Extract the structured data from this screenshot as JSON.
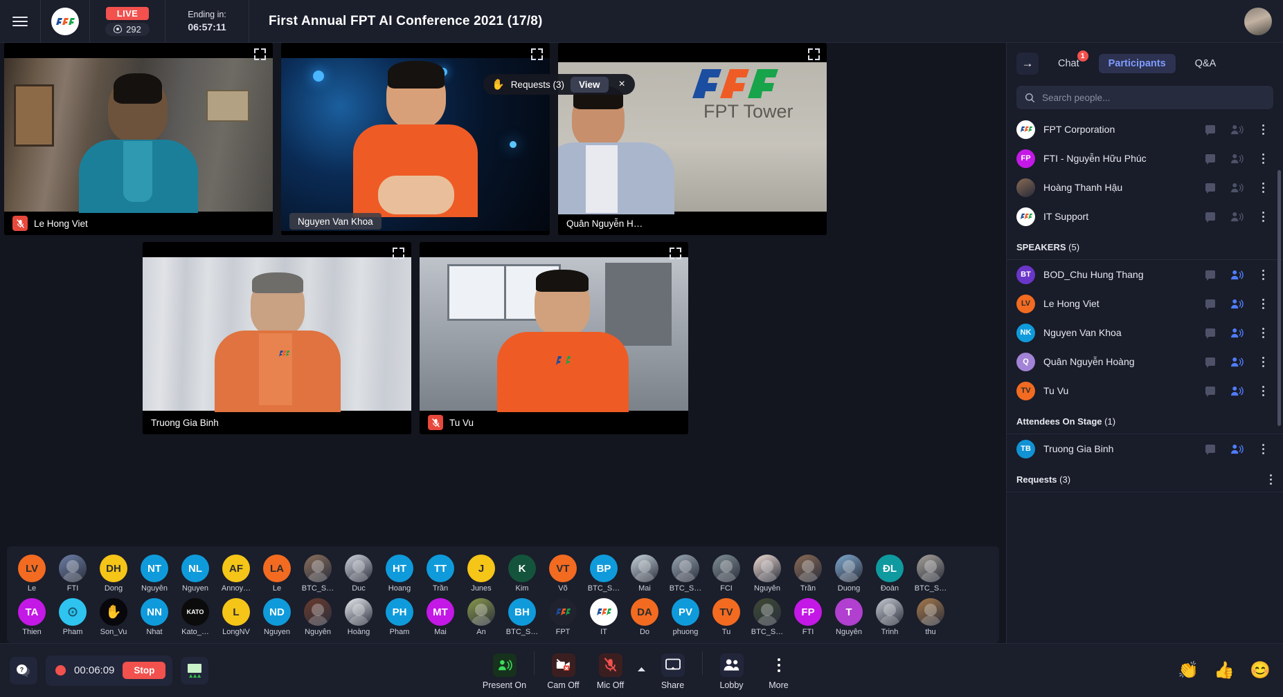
{
  "topbar": {
    "menu_icon": "hamburger-icon",
    "logo_text": "FPT",
    "live_label": "LIVE",
    "view_count": "292",
    "ending_label": "Ending in:",
    "ending_time": "06:57:11",
    "meeting_title": "First Annual FPT AI Conference 2021 (17/8)"
  },
  "request_toast": {
    "hand_icon": "raised-hand-icon",
    "label": "Requests (3)",
    "view_label": "View",
    "close_label": "×"
  },
  "tiles": [
    {
      "name": "Le Hong Viet",
      "muted": true,
      "float": false
    },
    {
      "name": "Nguyen Van Khoa",
      "muted": false,
      "float": true
    },
    {
      "name": "Quân Nguyễn H…",
      "muted": false,
      "float": false
    },
    {
      "name": "Truong Gia Binh",
      "muted": false,
      "float": false
    },
    {
      "name": "Tu Vu",
      "muted": true,
      "float": false
    }
  ],
  "avatar_strip": {
    "row1": [
      {
        "initials": "LV",
        "name": "Le",
        "color": "#f26b21",
        "photo": false,
        "txt": "#2b2b2b"
      },
      {
        "initials": "",
        "name": "FTI",
        "color": "#6d7fa6",
        "photo": true
      },
      {
        "initials": "DH",
        "name": "Dong",
        "color": "#f5c518",
        "photo": false,
        "txt": "#2b2b2b"
      },
      {
        "initials": "NT",
        "name": "Nguyễn",
        "color": "#0f9bdb",
        "photo": false
      },
      {
        "initials": "NL",
        "name": "Nguyen",
        "color": "#0f9bdb",
        "photo": false
      },
      {
        "initials": "AF",
        "name": "Annoy…",
        "color": "#f5c518",
        "photo": false,
        "txt": "#2b2b2b"
      },
      {
        "initials": "LA",
        "name": "Le",
        "color": "#f26b21",
        "photo": false,
        "txt": "#2b2b2b"
      },
      {
        "initials": "",
        "name": "BTC_S…",
        "color": "#8a6f5c",
        "photo": true
      },
      {
        "initials": "",
        "name": "Duc",
        "color": "#cfd4de",
        "photo": true
      },
      {
        "initials": "HT",
        "name": "Hoang",
        "color": "#0f9bdb",
        "photo": false
      },
      {
        "initials": "TT",
        "name": "Trần",
        "color": "#0f9bdb",
        "photo": false
      },
      {
        "initials": "J",
        "name": "Junes",
        "color": "#f5c518",
        "photo": false,
        "txt": "#2b2b2b"
      },
      {
        "initials": "K",
        "name": "Kim",
        "color": "#14543c",
        "photo": false
      },
      {
        "initials": "VT",
        "name": "Võ",
        "color": "#f26b21",
        "photo": false,
        "txt": "#2b2b2b"
      },
      {
        "initials": "BP",
        "name": "BTC_S…",
        "color": "#0f9bdb",
        "photo": false
      },
      {
        "initials": "",
        "name": "Mai",
        "color": "#c9d6de",
        "photo": true
      },
      {
        "initials": "",
        "name": "BTC_S…",
        "color": "#9aa7b4",
        "photo": true
      },
      {
        "initials": "",
        "name": "FCI",
        "color": "#7f8e94",
        "photo": true
      },
      {
        "initials": "",
        "name": "Nguyễn",
        "color": "#f0ddd4",
        "photo": true
      },
      {
        "initials": "",
        "name": "Trần",
        "color": "#8a6a54",
        "photo": true
      },
      {
        "initials": "",
        "name": "Duong",
        "color": "#7fa8cf",
        "photo": true
      },
      {
        "initials": "ĐL",
        "name": "Đoàn",
        "color": "#0f9aa0",
        "photo": false
      },
      {
        "initials": "",
        "name": "BTC_S…",
        "color": "#a8a29a",
        "photo": true
      }
    ],
    "row2": [
      {
        "initials": "TA",
        "name": "Thien",
        "color": "#c318e6",
        "photo": false
      },
      {
        "initials": "",
        "name": "Pham",
        "color": "#2ec4ef",
        "photo": false,
        "glyph": "⊙",
        "txt": "#18607a"
      },
      {
        "initials": "",
        "name": "Son_Vu",
        "color": "#07070c",
        "photo": false,
        "glyph": "✋"
      },
      {
        "initials": "NN",
        "name": "Nhat",
        "color": "#0f9bdb",
        "photo": false
      },
      {
        "initials": "KATO",
        "name": "Kato_…",
        "color": "#0b0b0b",
        "photo": false,
        "small": true
      },
      {
        "initials": "L",
        "name": "LongNV",
        "color": "#f5c518",
        "photo": false,
        "txt": "#2b2b2b"
      },
      {
        "initials": "ND",
        "name": "Nguyen",
        "color": "#0f9bdb",
        "photo": false
      },
      {
        "initials": "",
        "name": "Nguyễn",
        "color": "#6b3a2c",
        "photo": true
      },
      {
        "initials": "",
        "name": "Hoàng",
        "color": "#eceff4",
        "photo": true
      },
      {
        "initials": "PH",
        "name": "Pham",
        "color": "#0f9bdb",
        "photo": false
      },
      {
        "initials": "MT",
        "name": "Mai",
        "color": "#c318e6",
        "photo": false
      },
      {
        "initials": "",
        "name": "An",
        "color": "#8a9a4a",
        "photo": true
      },
      {
        "initials": "BH",
        "name": "BTC_S…",
        "color": "#0f9bdb",
        "photo": false
      },
      {
        "initials": "",
        "name": "FPT",
        "color": "#20232e",
        "photo": false,
        "glyph": "fpt"
      },
      {
        "initials": "",
        "name": "IT",
        "color": "#ffffff",
        "photo": false,
        "glyph": "fpt"
      },
      {
        "initials": "DA",
        "name": "Do",
        "color": "#f26b21",
        "photo": false,
        "txt": "#2b2b2b"
      },
      {
        "initials": "PV",
        "name": "phuong",
        "color": "#0f9bdb",
        "photo": false
      },
      {
        "initials": "TV",
        "name": "Tu",
        "color": "#f26b21",
        "photo": false,
        "txt": "#2b2b2b"
      },
      {
        "initials": "",
        "name": "BTC_S…",
        "color": "#3d4a33",
        "photo": true
      },
      {
        "initials": "FP",
        "name": "FTI",
        "color": "#c318e6",
        "photo": false
      },
      {
        "initials": "T",
        "name": "Nguyễn",
        "color": "#b13fd0",
        "photo": false
      },
      {
        "initials": "",
        "name": "Trinh",
        "color": "#c8ccd4",
        "photo": true
      },
      {
        "initials": "",
        "name": "thu",
        "color": "#a87a4a",
        "photo": true
      }
    ]
  },
  "right_panel": {
    "back_arrow": "→",
    "tabs": [
      {
        "label": "Chat",
        "active": false,
        "badge": "1"
      },
      {
        "label": "Participants",
        "active": true,
        "badge": ""
      },
      {
        "label": "Q&A",
        "active": false,
        "badge": ""
      }
    ],
    "search_placeholder": "Search people...",
    "top_list": [
      {
        "initials": "",
        "name": "FPT Corporation",
        "color": "#ffffff",
        "glyph": "fpt",
        "speaking": false
      },
      {
        "initials": "FP",
        "name": "FTI - Nguyễn Hữu Phúc",
        "color": "#c318e6",
        "speaking": false
      },
      {
        "initials": "",
        "name": "Hoàng Thanh Hậu",
        "color": "#8a6a54",
        "photo": true,
        "speaking": false
      },
      {
        "initials": "",
        "name": "IT Support",
        "color": "#ffffff",
        "glyph": "fpt",
        "speaking": false
      }
    ],
    "speakers_header": "SPEAKERS",
    "speakers_count": "(5)",
    "speakers": [
      {
        "initials": "BT",
        "name": "BOD_Chu Hung Thang",
        "color": "#6a36c9",
        "speaking": true
      },
      {
        "initials": "LV",
        "name": "Le Hong Viet",
        "color": "#f26b21",
        "speaking": true,
        "txt": "#2b2b2b"
      },
      {
        "initials": "NK",
        "name": "Nguyen Van Khoa",
        "color": "#0f9bdb",
        "speaking": true
      },
      {
        "initials": "Q",
        "name": "Quân Nguyễn Hoàng",
        "color": "#a283d6",
        "speaking": true
      },
      {
        "initials": "TV",
        "name": "Tu Vu",
        "color": "#f26b21",
        "speaking": true,
        "txt": "#2b2b2b"
      }
    ],
    "stage_header": "Attendees On Stage",
    "stage_count": "(1)",
    "stage": [
      {
        "initials": "TB",
        "name": "Truong Gia Binh",
        "color": "#1092d4",
        "speaking": true
      }
    ],
    "requests_header": "Requests",
    "requests_count": "(3)"
  },
  "bottombar": {
    "help_icon": "help-icon",
    "recording_time": "00:06:09",
    "stop_label": "Stop",
    "whiteboard_icon": "whiteboard-icon",
    "controls": [
      {
        "label": "Present On",
        "icon": "present-on-icon",
        "state": "on"
      },
      {
        "label": "Cam Off",
        "icon": "camera-off-icon",
        "state": "off"
      },
      {
        "label": "Mic Off",
        "icon": "mic-off-icon",
        "state": "off"
      },
      {
        "label": "Share",
        "icon": "share-screen-icon",
        "state": "neutral"
      },
      {
        "label": "Lobby",
        "icon": "people-icon",
        "state": "neutral"
      },
      {
        "label": "More",
        "icon": "more-icon",
        "state": "neutral"
      }
    ],
    "reactions": [
      "👏",
      "👍",
      "😊"
    ]
  },
  "colors": {
    "accent": "#7f9bff",
    "danger": "#f2514e",
    "panel": "#191c29",
    "bg": "#13151f"
  }
}
